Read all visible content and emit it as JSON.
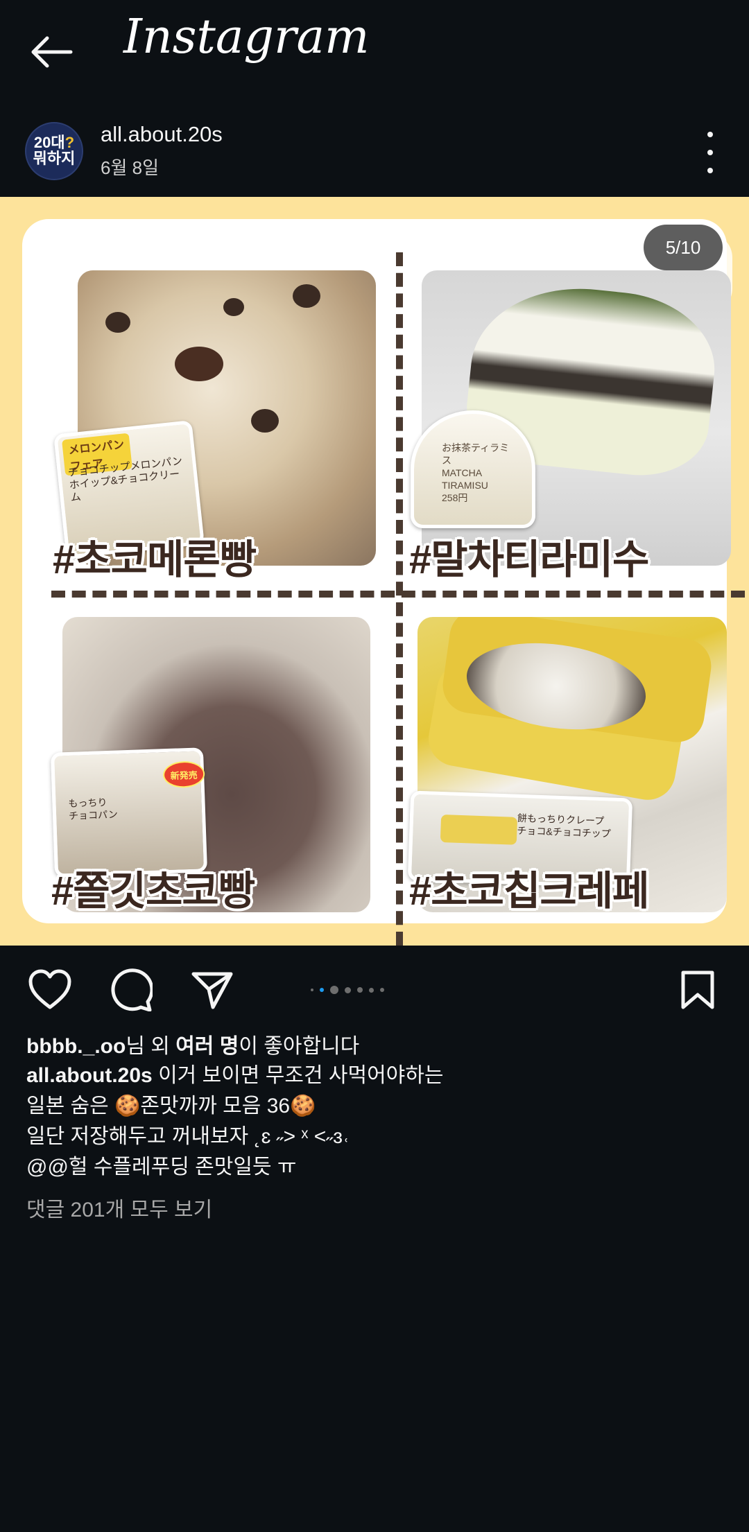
{
  "app": {
    "logo": "Instagram"
  },
  "post": {
    "author": {
      "username": "all.about.20s",
      "avatar_text_line1": "20대",
      "avatar_question": "?",
      "avatar_text_line2": "뭐하지"
    },
    "date": "6월 8일",
    "media_counter": "5/10",
    "image": {
      "labels": [
        "#초코메론빵",
        "#말차티라미수",
        "#쫄깃초코빵",
        "#초코칩크레페"
      ],
      "package_texts": {
        "melon_tag": "メロンパン\nフェア",
        "melon": "チョコチップメロンパン\nホイップ&チョコクリーム",
        "tiramisu": "お抹茶ティラミス\nMATCHA TIRAMISU\n258円",
        "choco_badge": "新発売",
        "choco": "もっちり\nチョコパン",
        "crepe": "餅もっちりクレープ\nチョコ&チョコチップ"
      }
    },
    "carousel": {
      "total": 7,
      "active_index": 1
    },
    "likes": {
      "prefix": "bbbb._.oo",
      "middle": "님 외 ",
      "bold": "여러 명",
      "suffix": "이 좋아합니다"
    },
    "caption": {
      "username": "all.about.20s",
      "line1": " 이거 보이면 무조건 사먹어야하는",
      "line2": "일본 숨은 🍪존맛까까 모음 36🍪",
      "line3": "일단 저장해두고 꺼내보자 ˛ɛ ˶> ˣ <˶ɜ˓",
      "line4": "@@헐 수플레푸딩 존맛일듯 ㅠ"
    },
    "comments_link": "댓글 201개 모두 보기"
  },
  "colors": {
    "background": "#0c1014",
    "media_background": "#fde39b",
    "label_text": "#3b2820",
    "carousel_active": "#1d9bf0"
  },
  "icons": [
    "back-arrow-icon",
    "more-vertical-icon",
    "heart-icon",
    "comment-icon",
    "share-icon",
    "bookmark-icon"
  ]
}
